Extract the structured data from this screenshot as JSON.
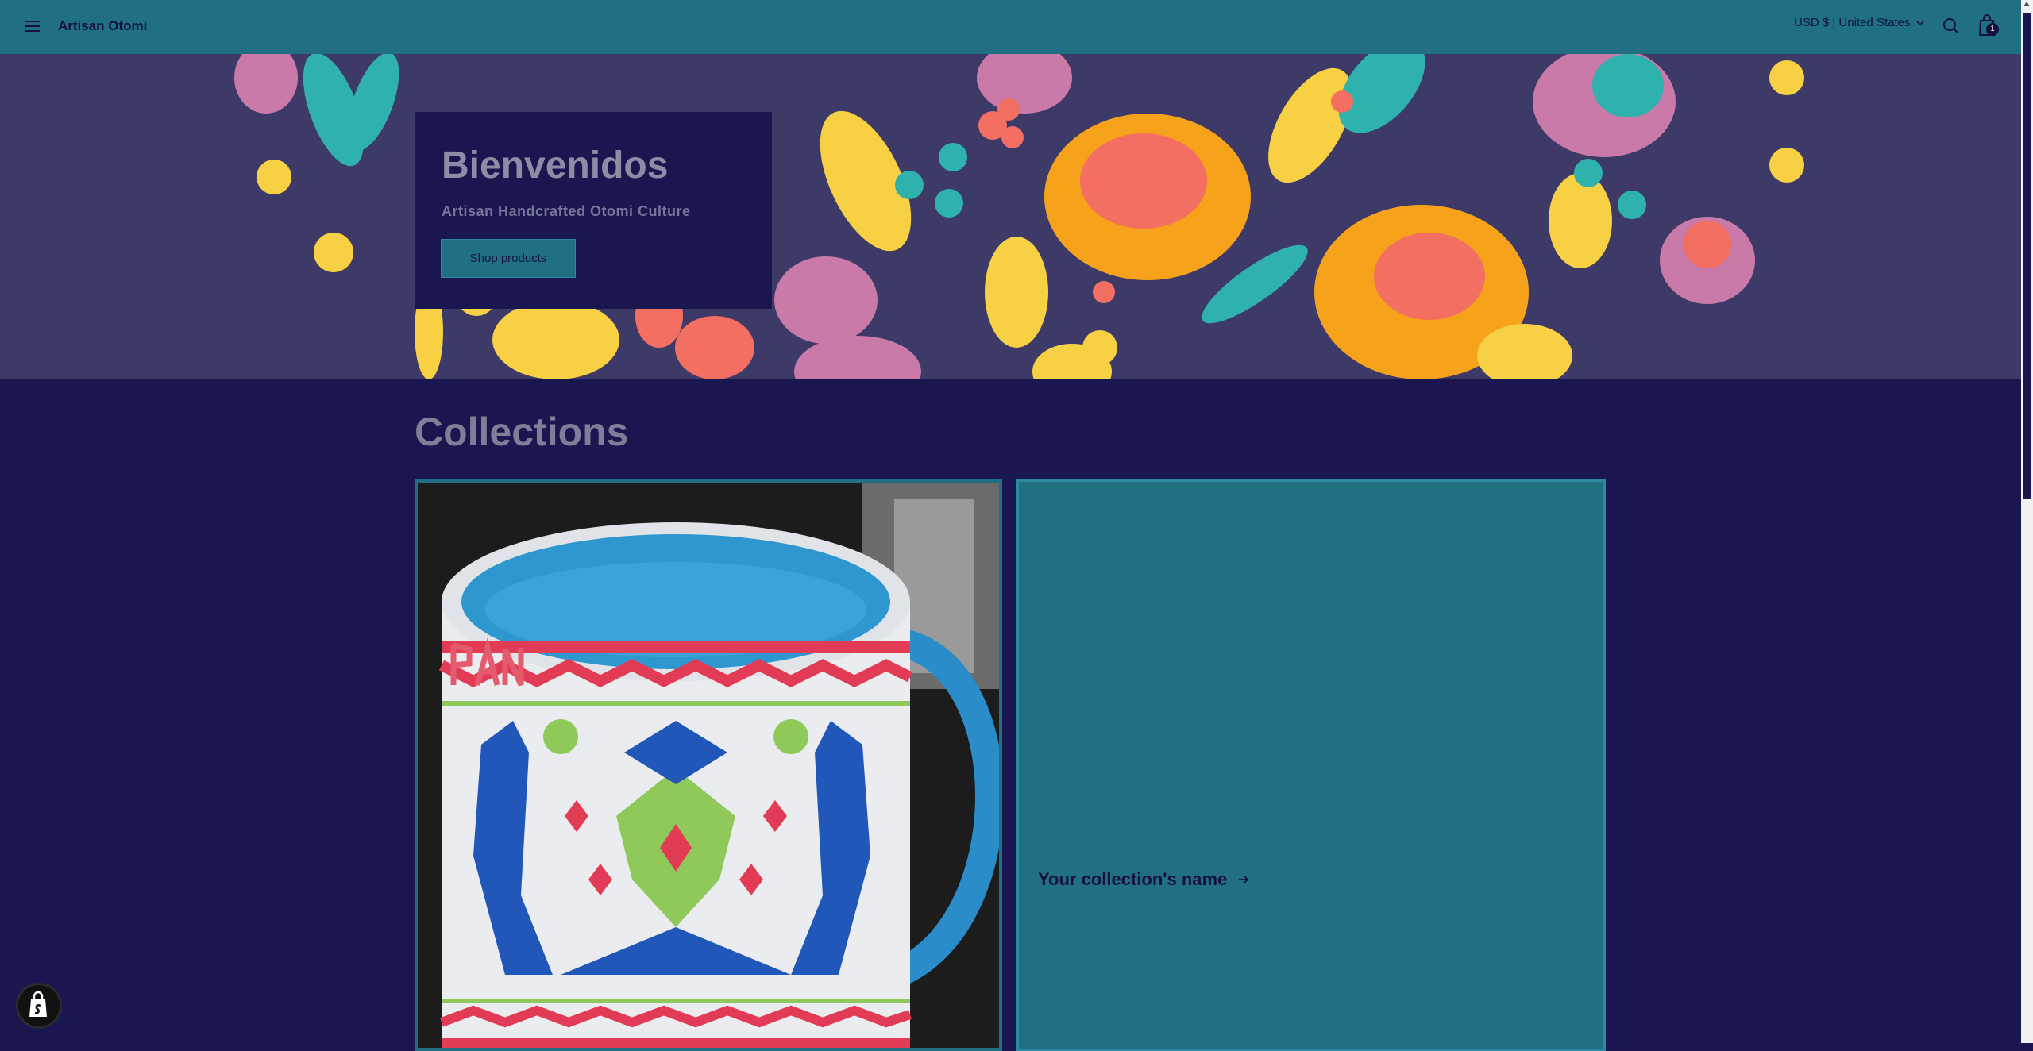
{
  "header": {
    "brand": "Artisan Otomi",
    "currency": "USD $ | United States",
    "cart_count": "1",
    "icons": [
      "menu-icon",
      "search-icon",
      "cart-icon",
      "chevron-down-icon"
    ]
  },
  "hero": {
    "title": "Bienvenidos",
    "subtitle": "Artisan Handcrafted Otomi Culture",
    "button_label": "Shop products"
  },
  "collections": {
    "title": "Collections",
    "cards": [
      {
        "label": "",
        "image": "otomi mug"
      },
      {
        "label": "Your collection's name"
      }
    ]
  },
  "colors": {
    "header_bg": "#216f82",
    "page_bg": "#1a164f",
    "hero_bg": "#3e3a68"
  }
}
